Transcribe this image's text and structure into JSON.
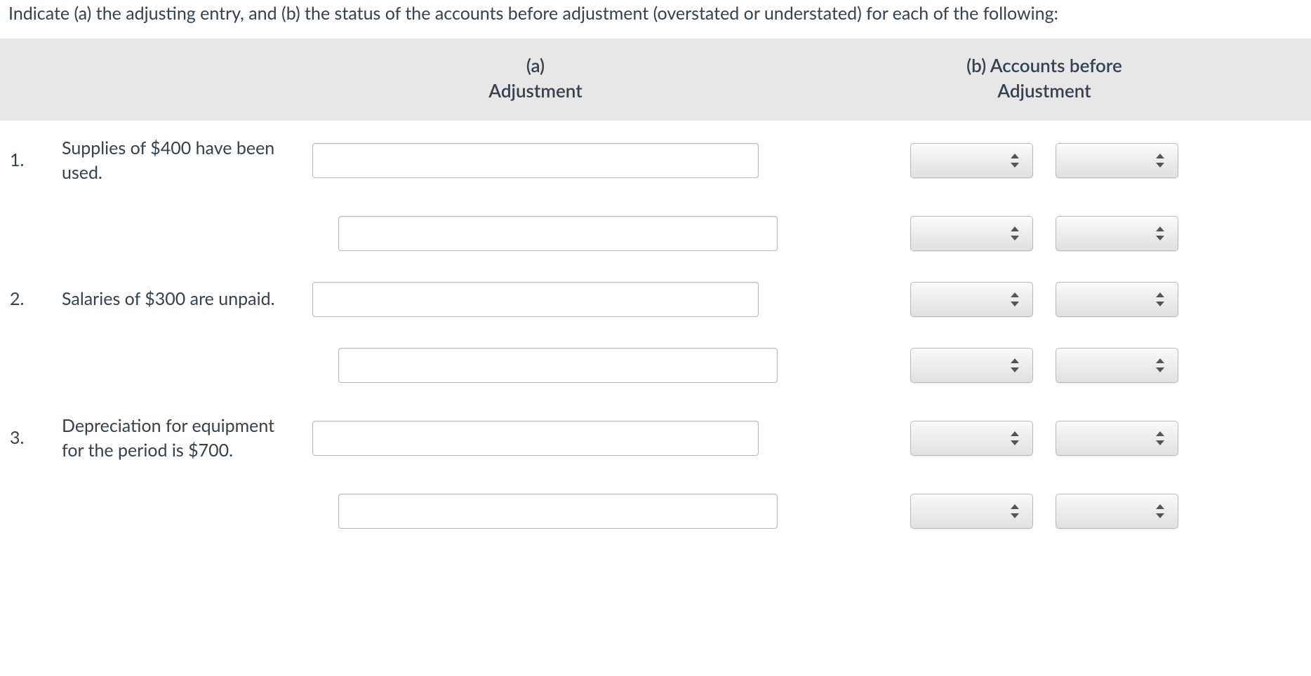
{
  "prompt": "Indicate (a) the adjusting entry, and (b) the status of the accounts before adjustment (overstated or understated) for each of the following:",
  "headers": {
    "a_line1": "(a)",
    "a_line2": "Adjustment",
    "b_line1": "(b) Accounts before",
    "b_line2": "Adjustment"
  },
  "rows": [
    {
      "num": "1.",
      "desc": "Supplies of $400 have been used.",
      "adjustment1": "",
      "adjustment2": "",
      "b1_select1": "",
      "b1_select2": "",
      "b2_select1": "",
      "b2_select2": ""
    },
    {
      "num": "2.",
      "desc": "Salaries of $300 are unpaid.",
      "adjustment1": "",
      "adjustment2": "",
      "b1_select1": "",
      "b1_select2": "",
      "b2_select1": "",
      "b2_select2": ""
    },
    {
      "num": "3.",
      "desc": "Depreciation for equipment for the period is $700.",
      "adjustment1": "",
      "adjustment2": "",
      "b1_select1": "",
      "b1_select2": "",
      "b2_select1": "",
      "b2_select2": ""
    }
  ]
}
